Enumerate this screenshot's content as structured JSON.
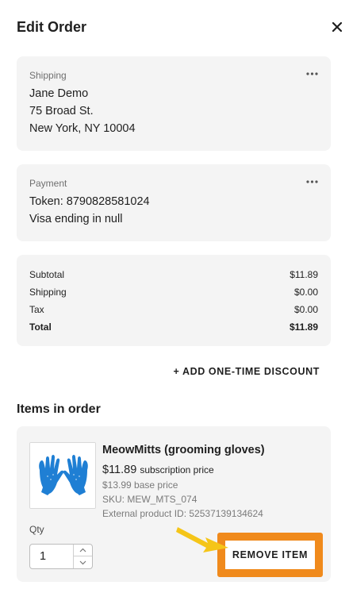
{
  "header": {
    "title": "Edit Order"
  },
  "shipping": {
    "label": "Shipping",
    "name": "Jane Demo",
    "street": "75 Broad St.",
    "city": "New York, NY 10004"
  },
  "payment": {
    "label": "Payment",
    "token": "Token: 8790828581024",
    "card": "Visa ending in null"
  },
  "summary": {
    "rows": [
      {
        "label": "Subtotal",
        "value": "$11.89"
      },
      {
        "label": "Shipping",
        "value": "$0.00"
      },
      {
        "label": "Tax",
        "value": "$0.00"
      },
      {
        "label": "Total",
        "value": "$11.89"
      }
    ]
  },
  "discount_label": "+ ADD ONE-TIME DISCOUNT",
  "items": {
    "title": "Items in order",
    "product": {
      "name": "MeowMitts (grooming gloves)",
      "price": "$11.89",
      "price_suffix": "subscription price",
      "base_price": "$13.99 base price",
      "sku": "SKU: MEW_MTS_074",
      "external_id": "External product ID: 52537139134624",
      "qty_label": "Qty",
      "qty_value": "1",
      "remove_label": "REMOVE ITEM"
    }
  },
  "colors": {
    "card_bg": "#f4f4f4",
    "highlight": "#f08a1c",
    "arrow": "#f5c518",
    "glove": "#1f7fd4"
  },
  "icons": [
    "close-icon",
    "more-icon",
    "chevron-up-icon",
    "chevron-down-icon",
    "pointer-arrow-icon"
  ]
}
